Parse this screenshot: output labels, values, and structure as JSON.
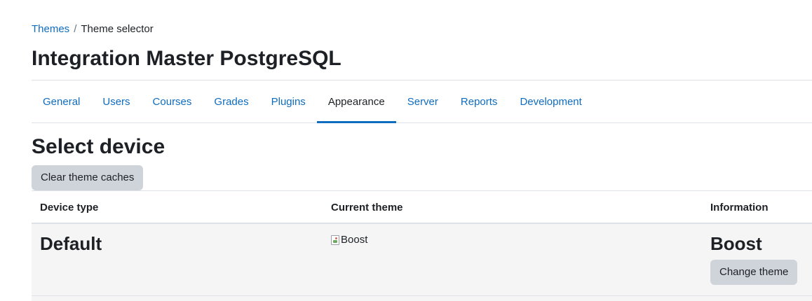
{
  "breadcrumb": {
    "items": [
      {
        "label": "Themes"
      },
      {
        "label": "Theme selector"
      }
    ],
    "separator": "/"
  },
  "page": {
    "title": "Integration Master PostgreSQL"
  },
  "nav": {
    "tabs": [
      {
        "label": "General"
      },
      {
        "label": "Users"
      },
      {
        "label": "Courses"
      },
      {
        "label": "Grades"
      },
      {
        "label": "Plugins"
      },
      {
        "label": "Appearance",
        "active": true
      },
      {
        "label": "Server"
      },
      {
        "label": "Reports"
      },
      {
        "label": "Development"
      }
    ]
  },
  "section": {
    "title": "Select device",
    "clear_caches_label": "Clear theme caches"
  },
  "table": {
    "headers": {
      "device_type": "Device type",
      "current_theme": "Current theme",
      "information": "Information"
    },
    "rows": [
      {
        "device_type": "Default",
        "theme_image_alt": "Boost",
        "theme_name": "Boost",
        "change_label": "Change theme"
      }
    ]
  },
  "colors": {
    "link": "#0f6cbf",
    "text": "#1d2125",
    "button_bg": "#ced4da",
    "row_bg": "#f5f5f5",
    "border": "#dee2e6"
  }
}
